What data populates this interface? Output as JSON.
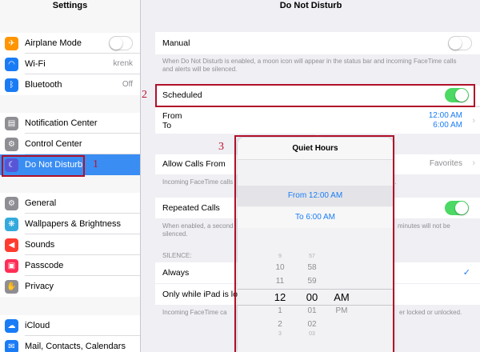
{
  "sidebar": {
    "title": "Settings",
    "items": [
      {
        "label": "Airplane Mode",
        "icon": "airplane-icon",
        "color": "#ff9500",
        "toggle": false
      },
      {
        "label": "Wi-Fi",
        "icon": "wifi-icon",
        "color": "#1a7cf5",
        "value": "krenk"
      },
      {
        "label": "Bluetooth",
        "icon": "bluetooth-icon",
        "color": "#1a7cf5",
        "value": "Off"
      },
      {
        "label": "Notification Center",
        "icon": "notification-center-icon",
        "color": "#8e8e93"
      },
      {
        "label": "Control Center",
        "icon": "control-center-icon",
        "color": "#8e8e93"
      },
      {
        "label": "Do Not Disturb",
        "icon": "moon-icon",
        "color": "#5856d6",
        "active": true
      },
      {
        "label": "General",
        "icon": "gear-icon",
        "color": "#8e8e93"
      },
      {
        "label": "Wallpapers & Brightness",
        "icon": "wallpaper-icon",
        "color": "#34aadc"
      },
      {
        "label": "Sounds",
        "icon": "speaker-icon",
        "color": "#ff3b30"
      },
      {
        "label": "Passcode",
        "icon": "lock-icon",
        "color": "#ff2d55"
      },
      {
        "label": "Privacy",
        "icon": "hand-icon",
        "color": "#8e8e93"
      },
      {
        "label": "iCloud",
        "icon": "cloud-icon",
        "color": "#1a7cf5"
      },
      {
        "label": "Mail, Contacts, Calendars",
        "icon": "mail-icon",
        "color": "#1a7cf5"
      }
    ]
  },
  "main": {
    "title": "Do Not Disturb",
    "manual": {
      "label": "Manual",
      "toggle": false,
      "footer": "When Do Not Disturb is enabled, a moon icon will appear in the status bar and incoming FaceTime calls and alerts will be silenced."
    },
    "scheduled": {
      "label": "Scheduled",
      "toggle": true
    },
    "from": {
      "label": "From",
      "value": "12:00 AM"
    },
    "to": {
      "label": "To",
      "value": "6:00 AM"
    },
    "allow_calls": {
      "label": "Allow Calls From",
      "value": "Favorites",
      "footer": "Incoming FaceTime calls"
    },
    "repeated": {
      "label": "Repeated Calls",
      "toggle": true,
      "footer_left": "When enabled, a second",
      "footer_right": "minutes will not be",
      "footer_line2": "silenced."
    },
    "silence_header": "SILENCE:",
    "always": {
      "label": "Always"
    },
    "only_locked": {
      "label": "Only while iPad is loc",
      "footer": "Incoming FaceTime ca",
      "footer_right": "er locked or unlocked."
    }
  },
  "popover": {
    "title": "Quiet Hours",
    "from_label": "From 12:00 AM",
    "to_label": "To 6:00 AM",
    "hours": [
      "9",
      "10",
      "11",
      "12",
      "1",
      "2",
      "3"
    ],
    "minutes": [
      "57",
      "58",
      "59",
      "00",
      "01",
      "02",
      "03"
    ],
    "ampm": [
      "AM",
      "PM"
    ]
  },
  "annotations": [
    "1",
    "2",
    "3"
  ],
  "colors": {
    "accent": "#1a7cf5",
    "toggle_on": "#4cd964",
    "annotation": "#b0102a",
    "active_row": "#3a8df2"
  }
}
